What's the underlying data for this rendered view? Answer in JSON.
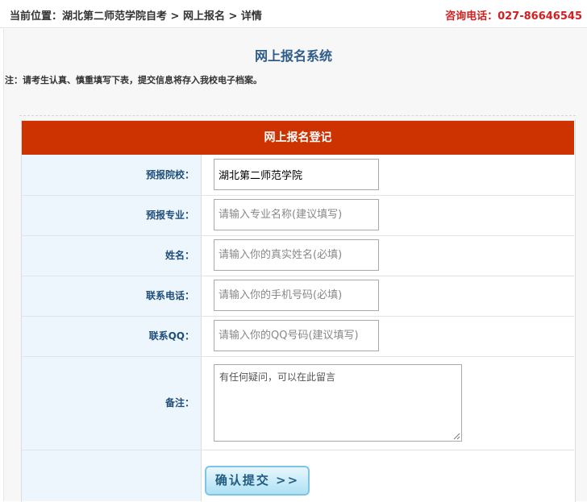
{
  "header": {
    "breadcrumb": "当前位置：湖北第二师范学院自考 > 网上报名 > 详情",
    "hotline": "咨询电话：027-86646545"
  },
  "page": {
    "title": "网上报名系统",
    "notice": "注：请考生认真、慎重填写下表，提交信息将存入我校电子档案。"
  },
  "form": {
    "header": "网上报名登记",
    "fields": [
      {
        "label": "预报院校：",
        "value": "湖北第二师范学院",
        "placeholder": ""
      },
      {
        "label": "预报专业：",
        "value": "",
        "placeholder": "请输入专业名称(建议填写)"
      },
      {
        "label": "姓名：",
        "value": "",
        "placeholder": "请输入你的真实姓名(必填)"
      },
      {
        "label": "联系电话：",
        "value": "",
        "placeholder": "请输入你的手机号码(必填)"
      },
      {
        "label": "联系QQ：",
        "value": "",
        "placeholder": "请输入你的QQ号码(建议填写)"
      }
    ],
    "memo": {
      "label": "备注：",
      "value": "有任何疑问，可以在此留言"
    },
    "submit_label": "确认提交 >>"
  },
  "colors": {
    "header_bg": "#cc3300",
    "label_bg": "#eef6fd",
    "label_text": "#1f4e79",
    "hotline": "#d21f1f",
    "title": "#2e5c8a"
  }
}
